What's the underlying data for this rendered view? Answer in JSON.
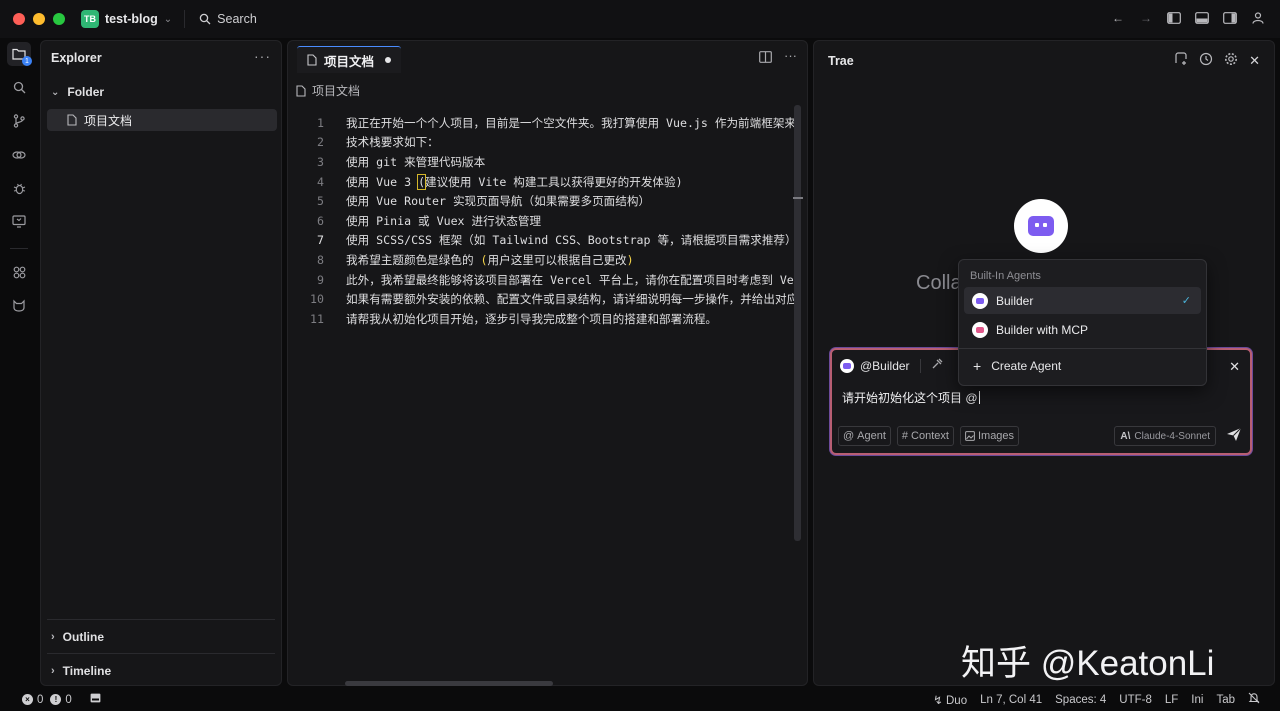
{
  "window": {
    "project_badge": "TB",
    "project_name": "test-blog",
    "search_label": "Search"
  },
  "explorer": {
    "title": "Explorer",
    "folder_label": "Folder",
    "files": [
      {
        "name": "项目文档"
      }
    ],
    "outline_label": "Outline",
    "timeline_label": "Timeline"
  },
  "activity": {
    "explorer_badge": "1"
  },
  "editor": {
    "tab_label": "项目文档",
    "breadcrumb": "项目文档",
    "lines": [
      {
        "n": "1",
        "text": "我正在开始一个个人项目，目前是一个空文件夹。我打算使用 Vue.js 作为前端框架来开"
      },
      {
        "n": "2",
        "text": "技术栈要求如下："
      },
      {
        "n": "3",
        "text": "使用 git 来管理代码版本"
      },
      {
        "n": "4",
        "pre": "使用 Vue 3 ",
        "box": "(",
        "post": "建议使用 Vite 构建工具以获得更好的开发体验)"
      },
      {
        "n": "5",
        "text": "使用 Vue Router 实现页面导航（如果需要多页面结构）"
      },
      {
        "n": "6",
        "text": "使用 Pinia 或 Vuex 进行状态管理"
      },
      {
        "n": "7",
        "text": "使用 SCSS/CSS 框架（如 Tailwind CSS、Bootstrap 等，请根据项目需求推荐）"
      },
      {
        "n": "8",
        "pre": "我希望主题颜色是绿色的 ",
        "yopen": "(",
        "mid": "用户这里可以根据自己更改",
        "yclose": ")"
      },
      {
        "n": "9",
        "text": "此外，我希望最终能够将该项目部署在 Vercel 平台上，请你在配置项目时考虑到 Verc"
      },
      {
        "n": "10",
        "text": "如果有需要额外安装的依赖、配置文件或目录结构，请详细说明每一步操作，并给出对应的"
      },
      {
        "n": "11",
        "text": "请帮我从初始化项目开始，逐步引导我完成整个项目的搭建和部署流程。"
      }
    ]
  },
  "chat": {
    "title": "Trae",
    "collab_text": "Colla",
    "composer": {
      "agent_label": "@Builder",
      "input_text": "请开始初始化这个项目 @",
      "agent_btn": "Agent",
      "context_btn": "Context",
      "images_btn": "Images",
      "model_label": "Claude-4-Sonnet"
    },
    "dropdown": {
      "heading": "Built-In Agents",
      "items": [
        {
          "label": "Builder"
        },
        {
          "label": "Builder with MCP"
        }
      ],
      "create_label": "Create Agent"
    }
  },
  "watermark": "知乎 @KeatonLi",
  "statusbar": {
    "errors": "0",
    "warnings": "0",
    "duo": "Duo",
    "position": "Ln 7, Col 41",
    "spaces": "Spaces: 4",
    "encoding": "UTF-8",
    "eol": "LF",
    "language": "Ini",
    "tab": "Tab"
  }
}
